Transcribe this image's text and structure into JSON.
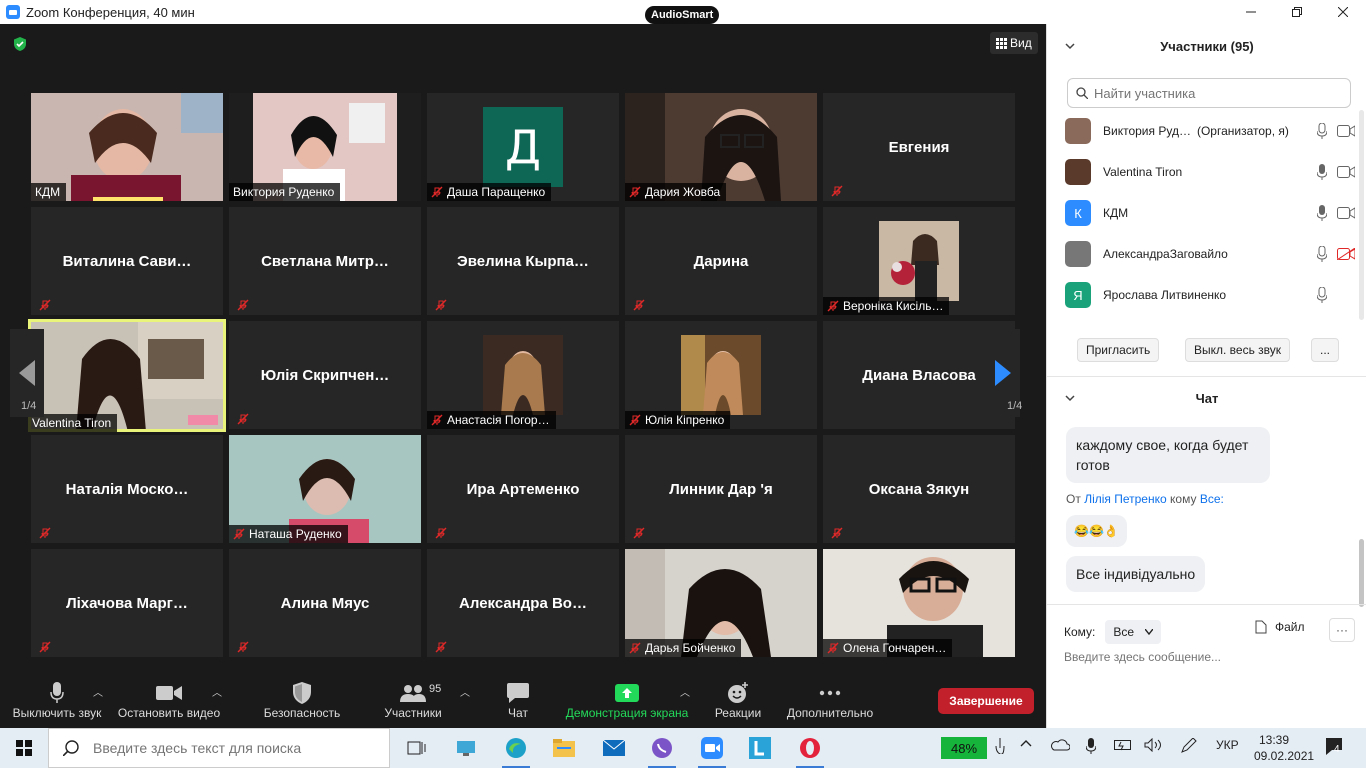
{
  "window": {
    "title": "Zoom Конференция, 40 мин",
    "badge": "AudioSmart"
  },
  "top_bar": {
    "view_label": "Вид"
  },
  "tiles": [
    {
      "name": "КДМ",
      "type": "video",
      "muted": false
    },
    {
      "name": "Виктория Руденко",
      "type": "video",
      "muted": false
    },
    {
      "name": "Даша Паращенко",
      "type": "letter",
      "letter": "Д",
      "muted": true
    },
    {
      "name": "Дария Жовба",
      "type": "video",
      "muted": true
    },
    {
      "name": "Евгения",
      "type": "name",
      "muted": true
    },
    {
      "name": "Виталина  Сави…",
      "type": "name",
      "muted": true
    },
    {
      "name": "Светлана  Митр…",
      "type": "name",
      "muted": true
    },
    {
      "name": "Эвелина  Кырпа…",
      "type": "name",
      "muted": true
    },
    {
      "name": "Дарина",
      "type": "name",
      "muted": true
    },
    {
      "name": "Вероніка Кисіль…",
      "type": "photo",
      "muted": true
    },
    {
      "name": "Valentina Tiron",
      "type": "video",
      "muted": false
    },
    {
      "name": "Юлія  Скрипчен…",
      "type": "name",
      "muted": true
    },
    {
      "name": "Анастасія Погор…",
      "type": "photo",
      "muted": true
    },
    {
      "name": "Юлія Кіпренко",
      "type": "photo",
      "muted": true
    },
    {
      "name": "Диана Власова",
      "type": "name",
      "muted": true
    },
    {
      "name": "Наталія  Моско…",
      "type": "name",
      "muted": true
    },
    {
      "name": "Наташа Руденко",
      "type": "video",
      "muted": true
    },
    {
      "name": "Ира Артеменко",
      "type": "name",
      "muted": true
    },
    {
      "name": "Линник Дар 'я",
      "type": "name",
      "muted": true
    },
    {
      "name": "Оксана Зякун",
      "type": "name",
      "muted": true
    },
    {
      "name": "Ліхачова  Марг…",
      "type": "name",
      "muted": true
    },
    {
      "name": "Алина Мяус",
      "type": "name",
      "muted": true
    },
    {
      "name": "Александра  Во…",
      "type": "name",
      "muted": true
    },
    {
      "name": "Дарья Бойченко",
      "type": "video",
      "muted": true
    },
    {
      "name": "Олена Гончарен…",
      "type": "video",
      "muted": true
    }
  ],
  "pager": {
    "left": "1/4",
    "right": "1/4"
  },
  "toolbar": {
    "mute": "Выключить звук",
    "video": "Остановить видео",
    "security": "Безопасность",
    "participants": "Участники",
    "participants_count": "95",
    "chat": "Чат",
    "share": "Демонстрация экрана",
    "reactions": "Реакции",
    "more": "Дополнительно",
    "end": "Завершение"
  },
  "participants_panel": {
    "title": "Участники (95)",
    "search_placeholder": "Найти участника",
    "items": [
      {
        "name": "Виктория Руд…",
        "role": "(Организатор, я)",
        "avatar": "photo",
        "color": "#8a6a5a"
      },
      {
        "name": "Valentina Tiron",
        "role": "",
        "avatar": "photo",
        "color": "#5a3a2a"
      },
      {
        "name": "КДМ",
        "role": "",
        "avatar": "К",
        "color": "#2d8cff"
      },
      {
        "name": "АлександраЗаговайло",
        "role": "",
        "avatar": "photo",
        "color": "#777777"
      },
      {
        "name": "Ярослава Литвиненко",
        "role": "",
        "avatar": "Я",
        "color": "#1aa37a"
      }
    ],
    "invite": "Пригласить",
    "mute_all": "Выкл. весь звук",
    "more": "..."
  },
  "chat": {
    "title": "Чат",
    "msg1": "каждому свое, когда будет готов",
    "from_prefix": "От",
    "from_name": "Лілія Петренко",
    "to_prefix": "кому",
    "to_name": "Все:",
    "msg2": "😂😂👌",
    "msg3": "Все індивідуально",
    "to_label": "Кому:",
    "to_value": "Все",
    "file": "Файл",
    "input_placeholder": "Введите здесь сообщение..."
  },
  "taskbar": {
    "search_placeholder": "Введите здесь текст для поиска",
    "battery": "48%",
    "lang": "УКР",
    "time": "13:39",
    "date": "09.02.2021",
    "notifications": "4"
  },
  "colors": {
    "accent": "#2d8cff",
    "end": "#c2212b",
    "share": "#23d959",
    "highlight": "#e8f57a"
  }
}
